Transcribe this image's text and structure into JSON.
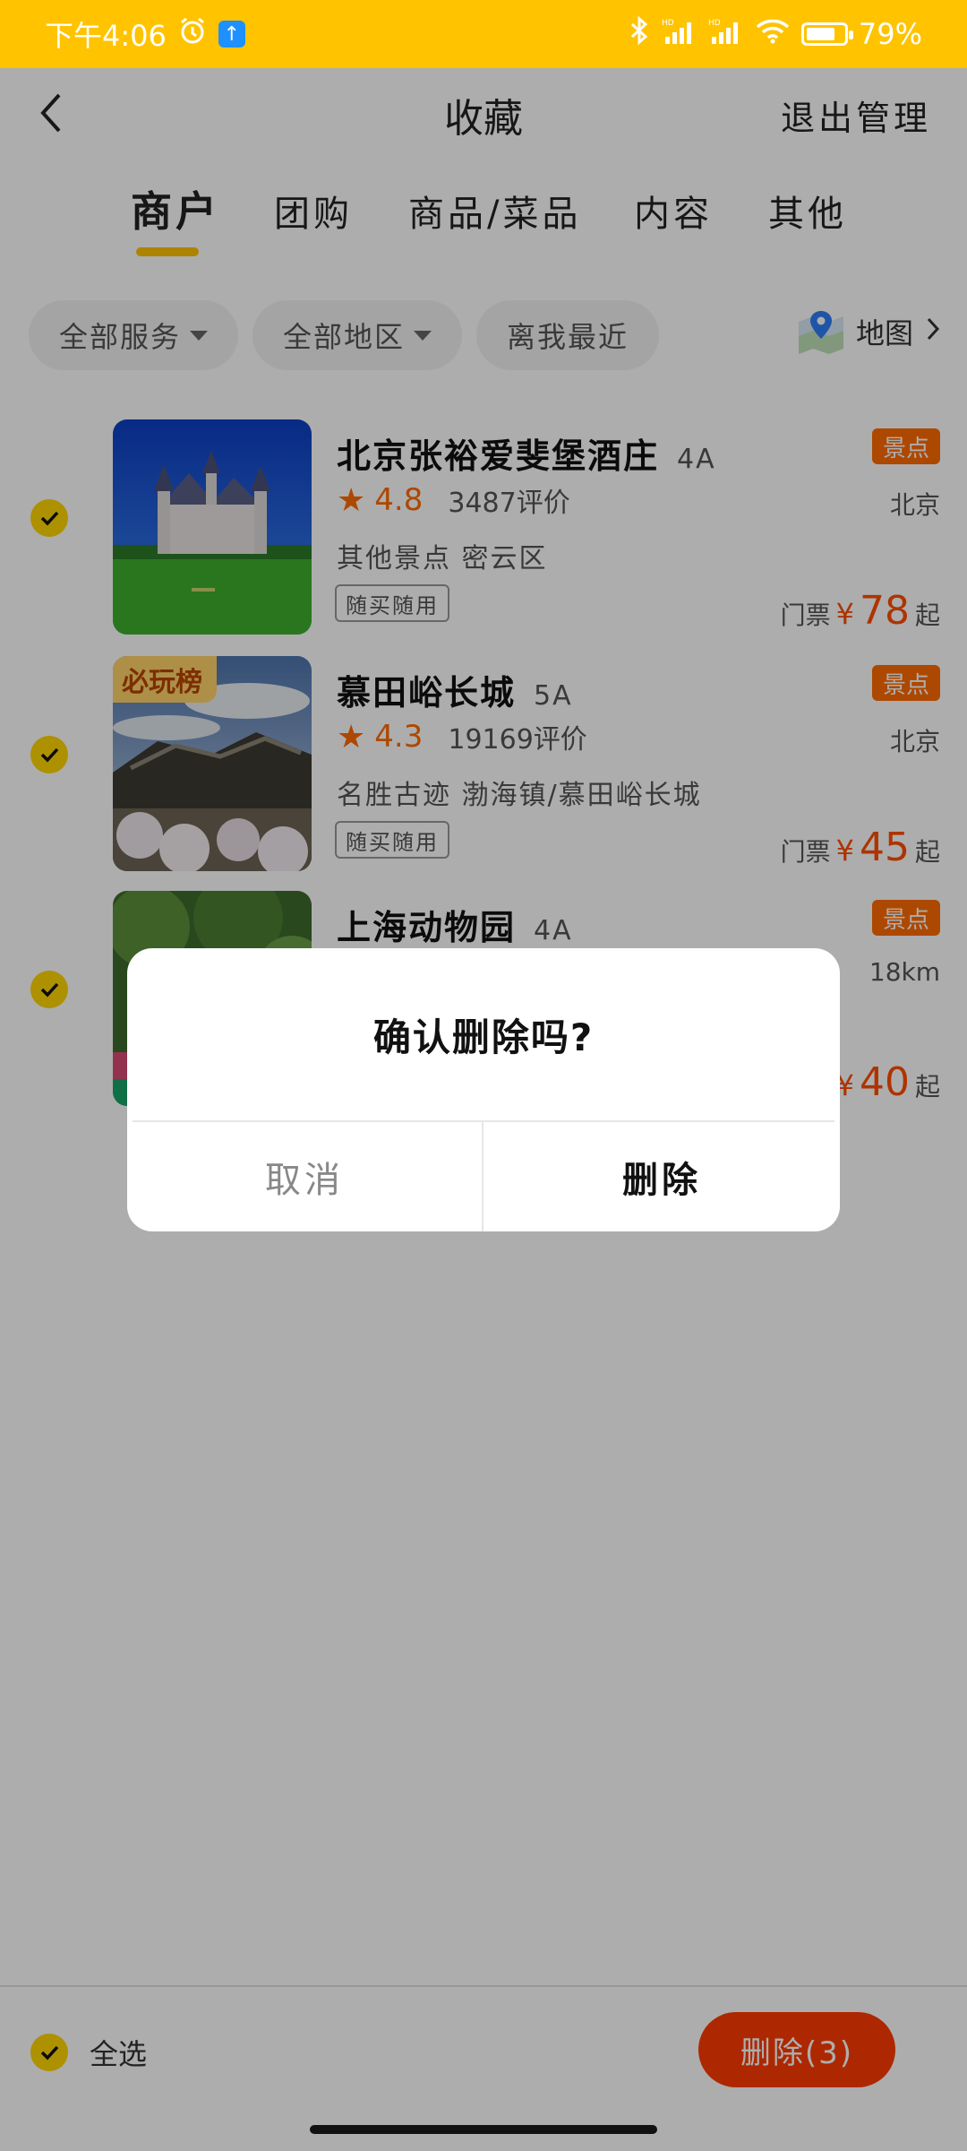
{
  "status_bar": {
    "time": "下午4:06",
    "network": "HD",
    "battery_percent": "79%",
    "battery_level": 0.79
  },
  "header": {
    "title": "收藏",
    "exit_manage": "退出管理"
  },
  "tabs": [
    {
      "label": "商户",
      "active": true
    },
    {
      "label": "团购",
      "active": false
    },
    {
      "label": "商品/菜品",
      "active": false
    },
    {
      "label": "内容",
      "active": false
    },
    {
      "label": "其他",
      "active": false
    }
  ],
  "filters": {
    "service": "全部服务",
    "region": "全部地区",
    "nearest": "离我最近",
    "map": "地图"
  },
  "items": [
    {
      "name": "北京张裕爱斐堡酒庄",
      "level": "4A",
      "tag": "景点",
      "rating": "4.8",
      "reviews": "3487评价",
      "location": "北京",
      "category": "其他景点  密云区",
      "use_tag": "随买随用",
      "price_label": "门票",
      "price_currency": "¥",
      "price": "78",
      "price_suffix": "起",
      "checked": true
    },
    {
      "name": "慕田峪长城",
      "level": "5A",
      "tag": "景点",
      "rating": "4.3",
      "reviews": "19169评价",
      "location": "北京",
      "category": "名胜古迹  渤海镇/慕田峪长城",
      "use_tag": "随买随用",
      "price_label": "门票",
      "price_currency": "¥",
      "price": "45",
      "price_suffix": "起",
      "rank_badge": "必玩榜",
      "checked": true
    },
    {
      "name": "上海动物园",
      "level": "4A",
      "tag": "景点",
      "location": "18km",
      "price_currency": "¥",
      "price": "40",
      "price_suffix": "起",
      "checked": true
    }
  ],
  "bottom_bar": {
    "select_all": "全选",
    "delete_button": "删除(3)"
  },
  "dialog": {
    "title": "确认删除吗?",
    "cancel": "取消",
    "confirm": "删除"
  },
  "colors": {
    "brand_yellow": "#ffc300",
    "accent_orange": "#ff6a00",
    "price_red": "#ff4d00",
    "delete_red": "#ff3b00"
  }
}
